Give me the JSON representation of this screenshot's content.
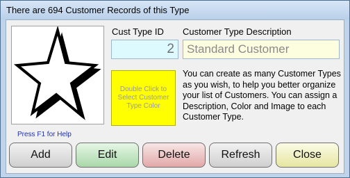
{
  "window": {
    "title": "There are 694 Customer Records of this Type"
  },
  "labels": {
    "cust_type_id": "Cust Type ID",
    "customer_type_description": "Customer Type Description"
  },
  "fields": {
    "cust_type_id_value": "2",
    "description_value": "Standard Customer"
  },
  "color_swatch": {
    "text": "Double Click to Select Customer Type Color",
    "color": "#ffff00"
  },
  "image": {
    "icon": "star-icon"
  },
  "info_text": "You can create as many Customer Types as you wish, to help you better organize your list of Customers.  You can assign a Description, Color and Image to each Customer Type.",
  "help_text": "Press F1 for Help",
  "buttons": {
    "add": "Add",
    "edit": "Edit",
    "delete": "Delete",
    "refresh": "Refresh",
    "close": "Close"
  },
  "colors": {
    "title_bar": "#c6dbf0",
    "id_field_bg": "#dcfaff",
    "description_field_bg": "#fdfde0",
    "help_text": "#1f2fb0",
    "edit_button": "#b8e0b8",
    "delete_button": "#ebb5b5",
    "close_button": "#ededb0"
  }
}
